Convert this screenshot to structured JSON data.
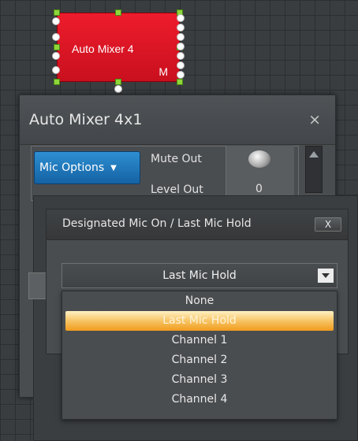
{
  "canvas_block": {
    "title": "Auto Mixer 4",
    "badge": "M",
    "color": "#e0161e"
  },
  "panel": {
    "title": "Auto Mixer 4x1",
    "close_glyph": "×",
    "mic_options_label": "Mic Options",
    "mute_out_label": "Mute Out",
    "level_out_label": "Level Out",
    "level_out_value": "0"
  },
  "dialog": {
    "title": "Designated Mic On / Last Mic Hold",
    "close_label": "X",
    "select_value": "Last Mic Hold",
    "options": [
      "None",
      "Last Mic Hold",
      "Channel 1",
      "Channel 2",
      "Channel 3",
      "Channel 4"
    ],
    "selected_index": 1,
    "highlight_color": "#f7b64a"
  }
}
